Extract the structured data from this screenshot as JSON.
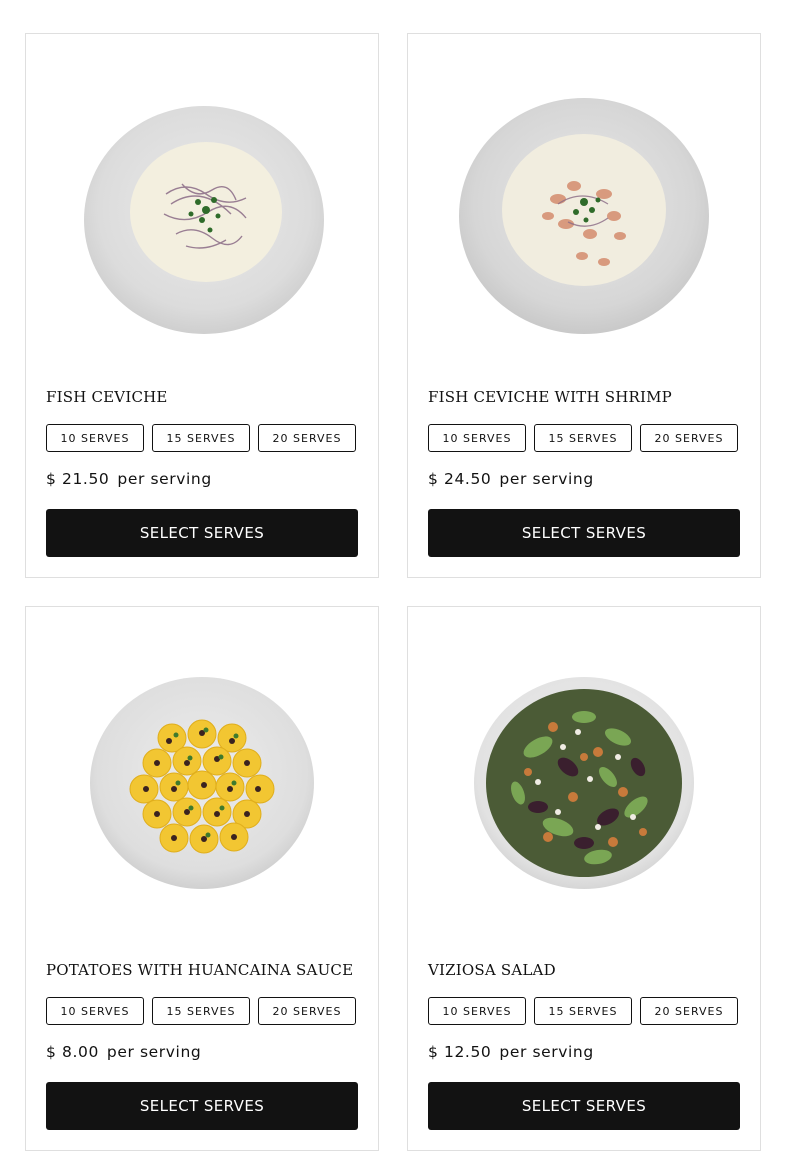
{
  "products": [
    {
      "title": "FISH CEVICHE",
      "serves": [
        "10 SERVES",
        "15 SERVES",
        "20 SERVES"
      ],
      "price": "$ 21.50",
      "price_suffix": "per serving",
      "button": "SELECT SERVES",
      "image_icon": "fish-ceviche-plate"
    },
    {
      "title": "FISH CEVICHE WITH SHRIMP",
      "serves": [
        "10 SERVES",
        "15 SERVES",
        "20 SERVES"
      ],
      "price": "$ 24.50",
      "price_suffix": "per serving",
      "button": "SELECT SERVES",
      "image_icon": "shrimp-ceviche-plate"
    },
    {
      "title": "POTATOES WITH HUANCAINA SAUCE",
      "serves": [
        "10 SERVES",
        "15 SERVES",
        "20 SERVES"
      ],
      "price": "$ 8.00",
      "price_suffix": "per serving",
      "button": "SELECT SERVES",
      "image_icon": "huancaina-potatoes-plate"
    },
    {
      "title": "VIZIOSA SALAD",
      "serves": [
        "10 SERVES",
        "15 SERVES",
        "20 SERVES"
      ],
      "price": "$ 12.50",
      "price_suffix": "per serving",
      "button": "SELECT SERVES",
      "image_icon": "salad-plate"
    }
  ],
  "colors": {
    "primary": "#121212",
    "card_border": "#dfdfdf",
    "background": "#ffffff"
  }
}
